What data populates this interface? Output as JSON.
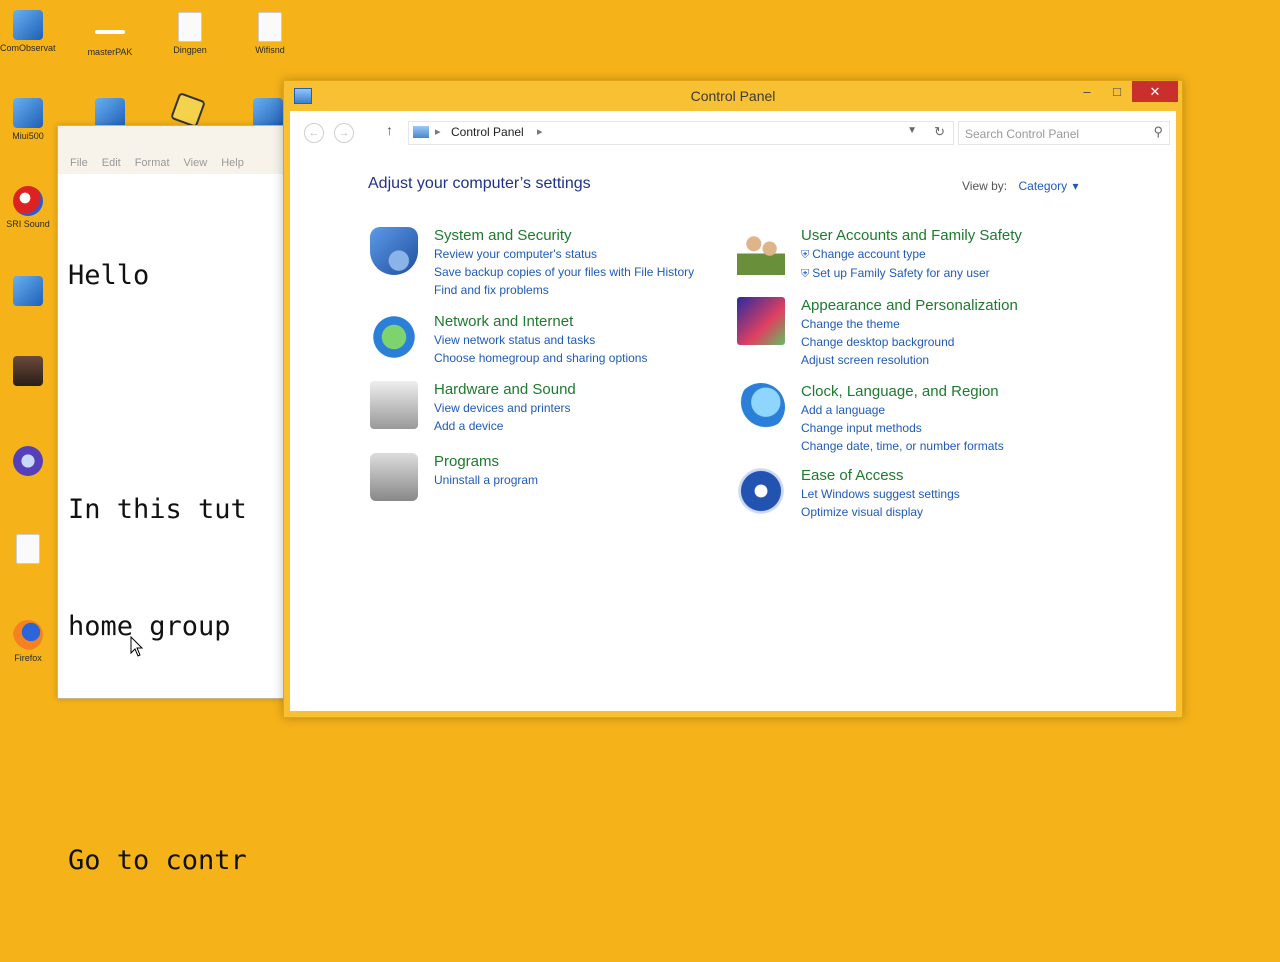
{
  "desktop": {
    "icons": [
      {
        "label": "ComObservations",
        "icon": "app-icon"
      },
      {
        "label": "masterPAK",
        "icon": "app-icon"
      },
      {
        "label": "Dingpen",
        "icon": "document-icon"
      },
      {
        "label": "Wifisnd",
        "icon": "document-icon"
      },
      {
        "label": "Miui500",
        "icon": "app-icon"
      },
      {
        "label": "",
        "icon": "app-icon"
      },
      {
        "label": "",
        "icon": "dice-icon"
      },
      {
        "label": "",
        "icon": "app-icon"
      },
      {
        "label": "SRI Sound",
        "icon": "browser-icon"
      },
      {
        "label": "",
        "icon": "app-icon"
      },
      {
        "label": "",
        "icon": "photo-icon"
      },
      {
        "label": "",
        "icon": "browser-icon"
      },
      {
        "label": "",
        "icon": "document-icon"
      },
      {
        "label": "Firefox",
        "icon": "firefox-icon"
      }
    ]
  },
  "notepad": {
    "menu": [
      "File",
      "Edit",
      "Format",
      "View",
      "Help"
    ],
    "lines": [
      "Hello",
      "",
      "In this tut",
      "home group ",
      "",
      "Go to contr"
    ]
  },
  "control_panel": {
    "title": "Control Panel",
    "breadcrumb": "Control Panel",
    "search_placeholder": "Search Control Panel",
    "heading": "Adjust your computer’s settings",
    "view_by_label": "View by:",
    "view_by_value": "Category",
    "categories_left": [
      {
        "title": "System and Security",
        "icon": "shield-icon",
        "links": [
          "Review your computer's status",
          "Save backup copies of your files with File History",
          "Find and fix problems"
        ]
      },
      {
        "title": "Network and Internet",
        "icon": "network-globe-icon",
        "links": [
          "View network status and tasks",
          "Choose homegroup and sharing options"
        ]
      },
      {
        "title": "Hardware and Sound",
        "icon": "printer-icon",
        "links": [
          "View devices and printers",
          "Add a device"
        ]
      },
      {
        "title": "Programs",
        "icon": "programs-icon",
        "links": [
          "Uninstall a program"
        ]
      }
    ],
    "categories_right": [
      {
        "title": "User Accounts and Family Safety",
        "icon": "users-icon",
        "links": [
          "Change account type",
          "Set up Family Safety for any user"
        ]
      },
      {
        "title": "Appearance and Personalization",
        "icon": "monitor-icon",
        "links": [
          "Change the theme",
          "Change desktop background",
          "Adjust screen resolution"
        ]
      },
      {
        "title": "Clock, Language, and Region",
        "icon": "clock-globe-icon",
        "links": [
          "Add a language",
          "Change input methods",
          "Change date, time, or number formats"
        ]
      },
      {
        "title": "Ease of Access",
        "icon": "ease-of-access-icon",
        "links": [
          "Let Windows suggest settings",
          "Optimize visual display"
        ]
      }
    ]
  }
}
